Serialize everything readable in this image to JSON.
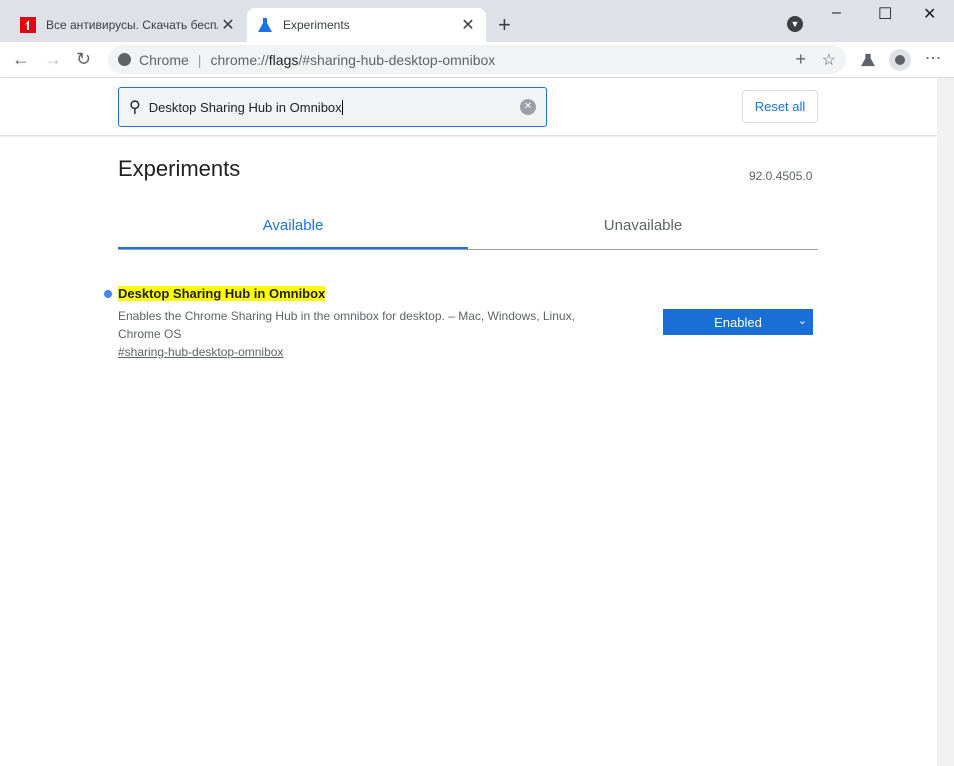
{
  "tabs": [
    {
      "title": "Все антивирусы. Скачать бесплатно",
      "icon": "antivirus-logo-icon",
      "active": false
    },
    {
      "title": "Experiments",
      "icon": "flask-icon",
      "active": true
    }
  ],
  "toolbar": {
    "site_label": "Chrome",
    "url_prefix": "chrome://",
    "url_host": "flags",
    "url_rest": "/#sharing-hub-desktop-omnibox"
  },
  "search": {
    "value": "Desktop Sharing Hub in Omnibox",
    "reset_label": "Reset all"
  },
  "page": {
    "title": "Experiments",
    "version": "92.0.4505.0",
    "tab_available": "Available",
    "tab_unavailable": "Unavailable"
  },
  "experiment": {
    "name": "Desktop Sharing Hub in Omnibox",
    "description": "Enables the Chrome Sharing Hub in the omnibox for desktop. – Mac, Windows, Linux, Chrome OS",
    "link": "#sharing-hub-desktop-omnibox",
    "selected": "Enabled"
  },
  "colors": {
    "accent": "#1a73e8",
    "select": "#1a6fd6",
    "highlight": "#ffff00"
  }
}
